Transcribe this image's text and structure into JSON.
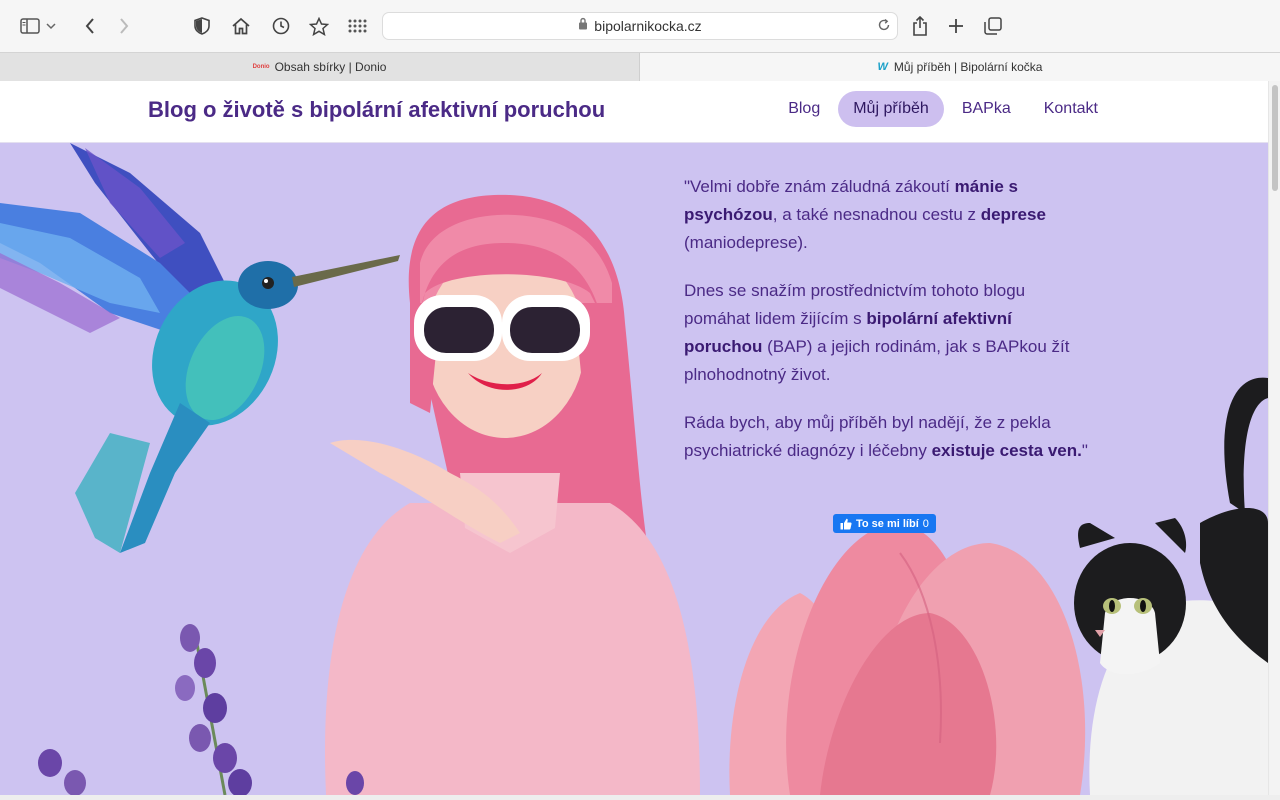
{
  "browser": {
    "url": "bipolarnikocka.cz",
    "tabs": [
      {
        "favicon_text": "Donio",
        "label": "Obsah sbírky | Donio"
      },
      {
        "favicon_text": "W",
        "label": "Můj příběh | Bipolární kočka"
      }
    ],
    "icons": [
      "sidebar-icon",
      "chevron-down-icon",
      "back-icon",
      "forward-icon",
      "privacy-shield-icon",
      "home-icon",
      "history-icon",
      "star-icon",
      "grid-icon",
      "lock-icon",
      "reload-icon",
      "share-icon",
      "plus-icon",
      "tabs-overview-icon"
    ]
  },
  "site": {
    "title": "Blog o životě s bipolární afektivní poruchou",
    "nav": [
      {
        "label": "Blog",
        "active": false
      },
      {
        "label": "Můj příběh",
        "active": true
      },
      {
        "label": "BAPka",
        "active": false
      },
      {
        "label": "Kontakt",
        "active": false
      }
    ]
  },
  "hero": {
    "quote": {
      "p1_a": "\"Velmi dobře znám záludná zákoutí ",
      "p1_b1": "mánie s psychózou",
      "p1_c": ", a také nesnadnou cestu z ",
      "p1_b2": "deprese",
      "p1_d": " (maniodeprese).",
      "p2_a": "Dnes se snažím prostřednictvím tohoto blogu pomáhat lidem žijícím s ",
      "p2_b": "bipolární afektivní poruchou",
      "p2_c": " (BAP) a jejich rodinám, jak s BAPkou žít plnohodnotný život.",
      "p3_a": "Ráda bych, aby můj příběh byl nadějí, že z pekla psychiatrické diagnózy i léčebny ",
      "p3_b": "existuje cesta ven.",
      "p3_c": "\""
    },
    "like_button": {
      "label": "To se mi líbí",
      "count": "0"
    }
  },
  "colors": {
    "accent": "#4b2a86",
    "hero_bg": "#cdc3f1",
    "nav_active_bg": "#cdbfef",
    "fb_blue": "#1877f2"
  }
}
